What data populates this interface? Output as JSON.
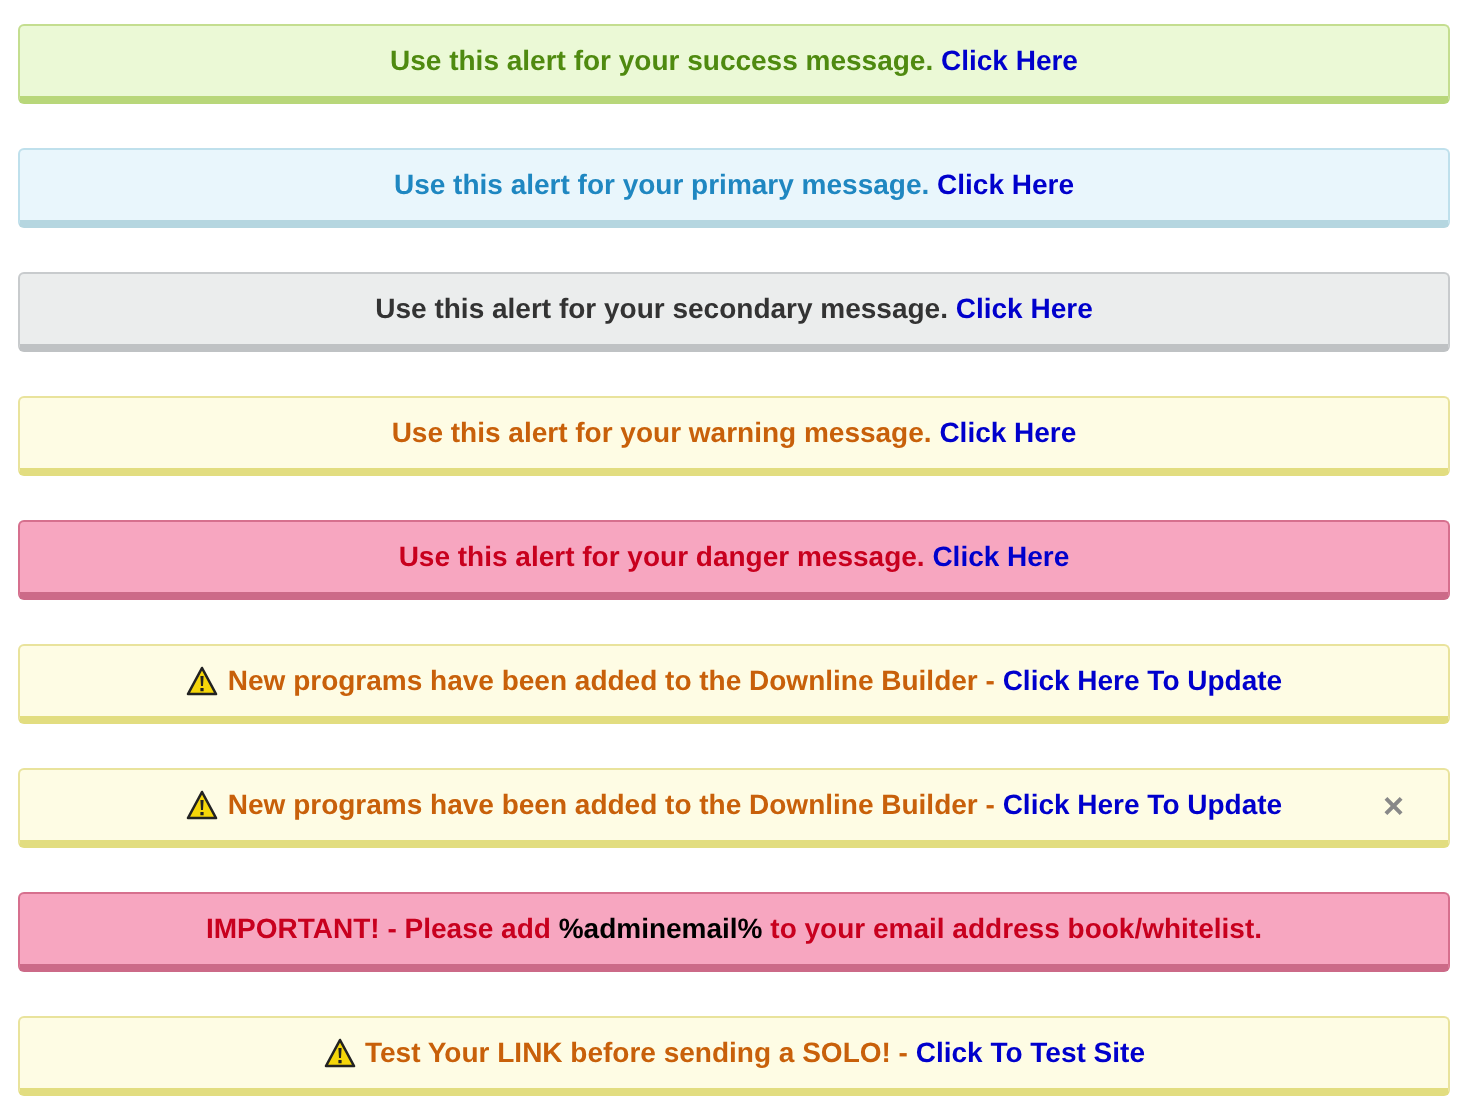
{
  "alerts": [
    {
      "kind": "success",
      "icon": false,
      "dismissible": false,
      "parts": [
        {
          "kind": "text",
          "text": "Use this alert for your success message. "
        },
        {
          "kind": "link",
          "text": "Click Here"
        }
      ]
    },
    {
      "kind": "primary",
      "icon": false,
      "dismissible": false,
      "parts": [
        {
          "kind": "text",
          "text": "Use this alert for your primary message. "
        },
        {
          "kind": "link",
          "text": "Click Here"
        }
      ]
    },
    {
      "kind": "secondary",
      "icon": false,
      "dismissible": false,
      "parts": [
        {
          "kind": "text",
          "text": "Use this alert for your secondary message. "
        },
        {
          "kind": "link",
          "text": "Click Here"
        }
      ]
    },
    {
      "kind": "warning",
      "icon": false,
      "dismissible": false,
      "parts": [
        {
          "kind": "text",
          "text": "Use this alert for your warning message. "
        },
        {
          "kind": "link",
          "text": "Click Here"
        }
      ]
    },
    {
      "kind": "danger",
      "icon": false,
      "dismissible": false,
      "parts": [
        {
          "kind": "text",
          "text": "Use this alert for your danger message. "
        },
        {
          "kind": "link",
          "text": "Click Here"
        }
      ]
    },
    {
      "kind": "warning",
      "icon": true,
      "dismissible": false,
      "parts": [
        {
          "kind": "text",
          "text": "New programs have been added to the Downline Builder - "
        },
        {
          "kind": "link",
          "text": "Click Here To Update"
        }
      ]
    },
    {
      "kind": "warning",
      "icon": true,
      "dismissible": true,
      "close": "×",
      "parts": [
        {
          "kind": "text",
          "text": "New programs have been added to the Downline Builder - "
        },
        {
          "kind": "link",
          "text": "Click Here To Update"
        }
      ]
    },
    {
      "kind": "danger",
      "icon": false,
      "dismissible": false,
      "parts": [
        {
          "kind": "text",
          "text": "IMPORTANT! - Please add "
        },
        {
          "kind": "highlight",
          "text": "%adminemail%"
        },
        {
          "kind": "text",
          "text": " to your email address book/whitelist."
        }
      ]
    },
    {
      "kind": "warning",
      "icon": true,
      "dismissible": false,
      "parts": [
        {
          "kind": "text",
          "text": "Test Your LINK before sending a SOLO! - "
        },
        {
          "kind": "link",
          "text": "Click To Test Site"
        }
      ]
    }
  ]
}
